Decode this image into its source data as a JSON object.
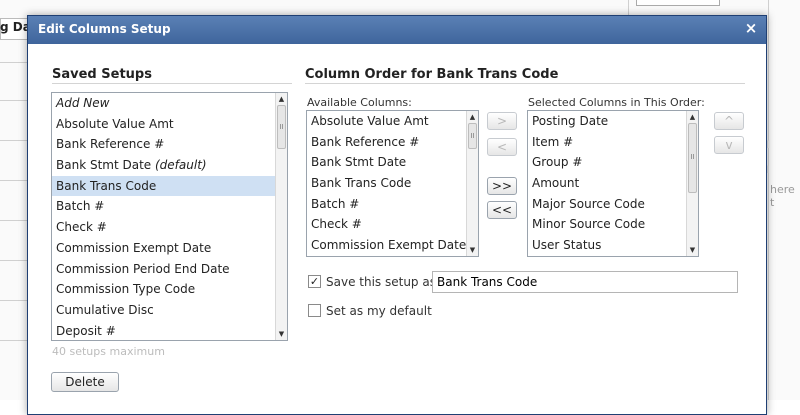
{
  "background": {
    "header_text": "g Dat",
    "ghost_char": "t",
    "ghost_text": "here t"
  },
  "dialog": {
    "title": "Edit Columns Setup",
    "close_symbol": "×"
  },
  "saved_setups": {
    "title": "Saved Setups",
    "items": [
      {
        "label": "Add New",
        "italic": true
      },
      {
        "label": "Absolute Value Amt"
      },
      {
        "label": "Bank Reference #"
      },
      {
        "label": "Bank Stmt Date",
        "suffix": "(default)"
      },
      {
        "label": "Bank Trans Code",
        "selected": true
      },
      {
        "label": "Batch #"
      },
      {
        "label": "Check #"
      },
      {
        "label": "Commission Exempt Date"
      },
      {
        "label": "Commission Period End Date"
      },
      {
        "label": "Commission Type Code"
      },
      {
        "label": "Cumulative Disc"
      },
      {
        "label": "Deposit #"
      }
    ],
    "max_note": "40 setups maximum",
    "delete_label": "Delete"
  },
  "column_order": {
    "title": "Column Order for Bank Trans Code",
    "available": {
      "label": "Available Columns:",
      "items": [
        "Absolute Value Amt",
        "Bank Reference #",
        "Bank Stmt Date",
        "Bank Trans Code",
        "Batch #",
        "Check #",
        "Commission Exempt Date"
      ]
    },
    "selected": {
      "label": "Selected Columns in This Order:",
      "items": [
        "Posting Date",
        "Item #",
        "Group #",
        "Amount",
        "Major Source Code",
        "Minor Source Code",
        "User Status"
      ]
    },
    "move_buttons": {
      "add": ">",
      "remove": "<",
      "add_all": ">>",
      "remove_all": "<<"
    },
    "order_buttons": {
      "up": "^",
      "down": "v"
    },
    "save_setup": {
      "checked": true,
      "check_mark": "✓",
      "label": "Save this setup as:",
      "value": "Bank Trans Code"
    },
    "set_default": {
      "checked": false,
      "label": "Set as my default"
    }
  },
  "icons": {
    "scroll_up": "▲",
    "scroll_down": "▼"
  }
}
